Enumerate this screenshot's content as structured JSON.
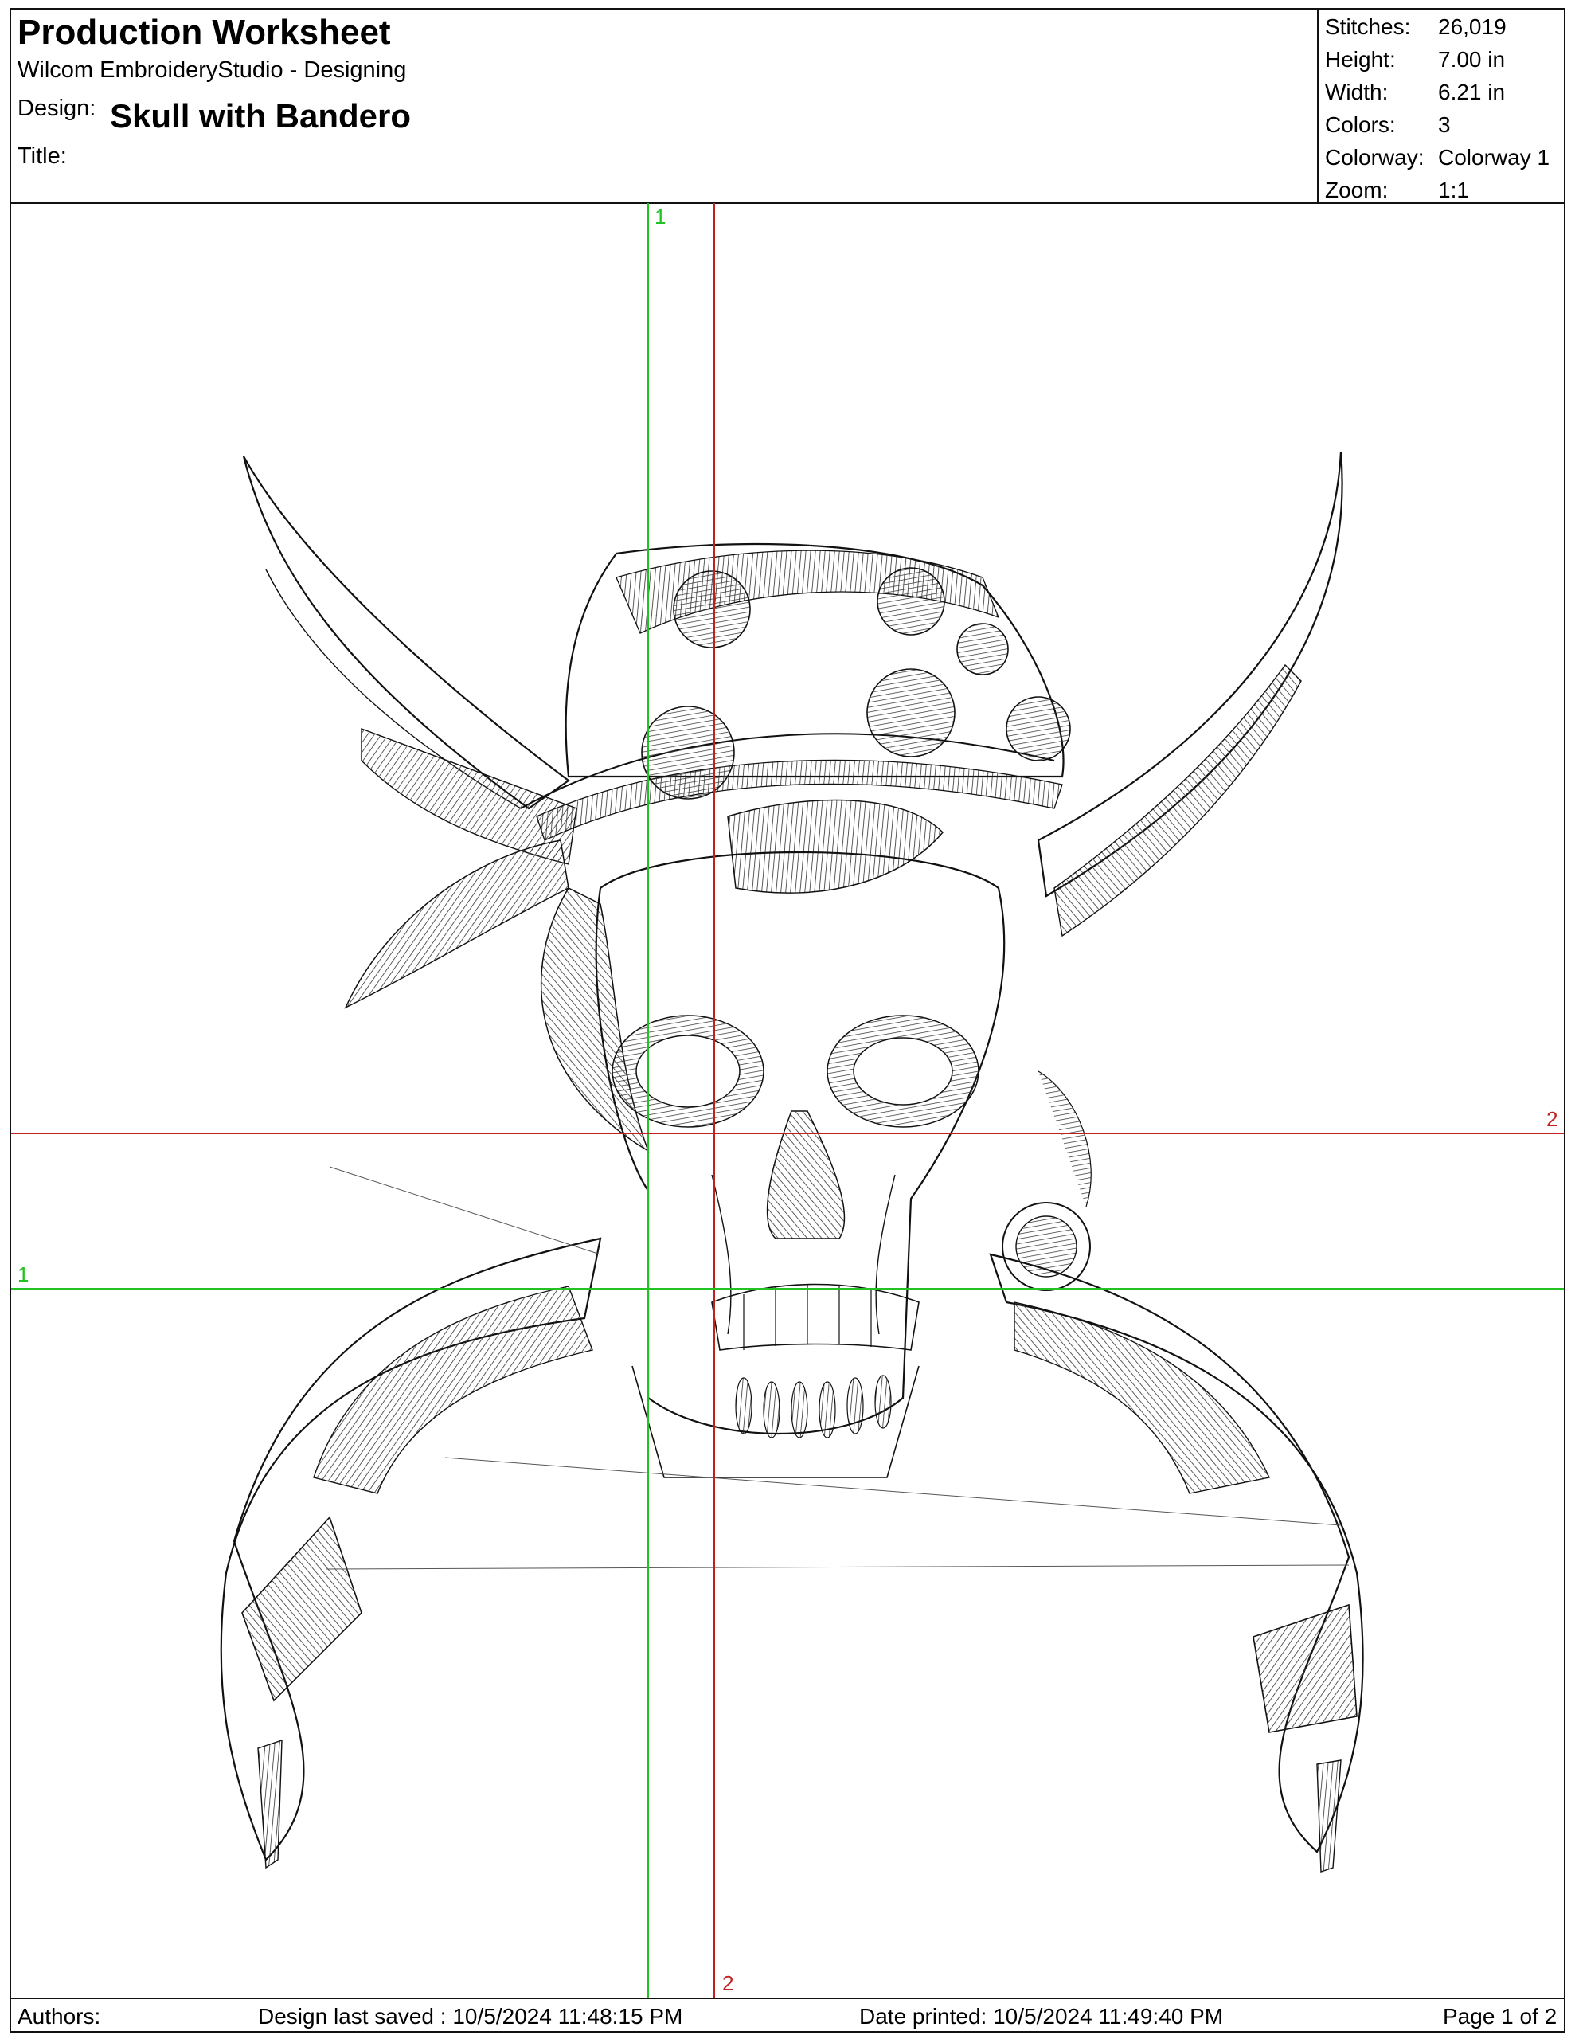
{
  "header": {
    "title": "Production Worksheet",
    "app": "Wilcom EmbroideryStudio - Designing",
    "design_label": "Design:",
    "design_name": "Skull with Bandero",
    "title_label": "Title:"
  },
  "stats": [
    {
      "label": "Stitches:",
      "value": "26,019"
    },
    {
      "label": "Height:",
      "value": "7.00 in"
    },
    {
      "label": "Width:",
      "value": "6.21 in"
    },
    {
      "label": "Colors:",
      "value": "3"
    },
    {
      "label": "Colorway:",
      "value": "Colorway 1"
    },
    {
      "label": "Zoom:",
      "value": "1:1"
    }
  ],
  "guides": {
    "v_green": "1",
    "v_red": "2",
    "h_red": "2",
    "h_green": "1",
    "green_color": "#22c222",
    "red_color": "#c02020"
  },
  "footer": {
    "authors": "Authors:",
    "last_saved": "Design last saved : 10/5/2024 11:48:15 PM",
    "printed": "Date printed: 10/5/2024 11:49:40 PM",
    "page": "Page 1 of 2"
  }
}
